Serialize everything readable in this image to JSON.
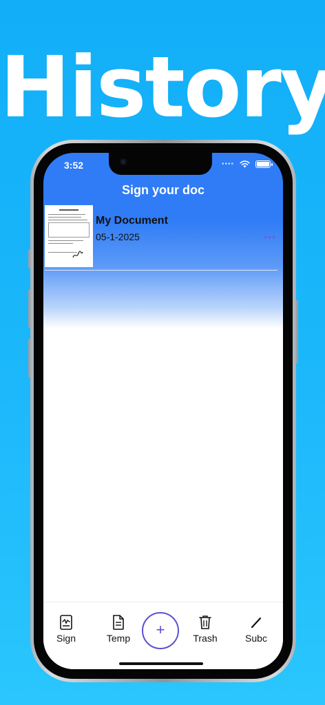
{
  "promo": {
    "title": "History"
  },
  "status": {
    "time": "3:52",
    "signal": "••••"
  },
  "app": {
    "title": "Sign your doc"
  },
  "documents": [
    {
      "name": "My Document",
      "date": "05-1-2025",
      "more": "•••"
    }
  ],
  "tabbar": {
    "sign": "Sign",
    "temp": "Temp",
    "add": "+",
    "trash": "Trash",
    "subc": "Subc"
  },
  "colors": {
    "accent": "#5b4fd0",
    "header": "#2f7cf6",
    "background": "#1cb8fb"
  }
}
